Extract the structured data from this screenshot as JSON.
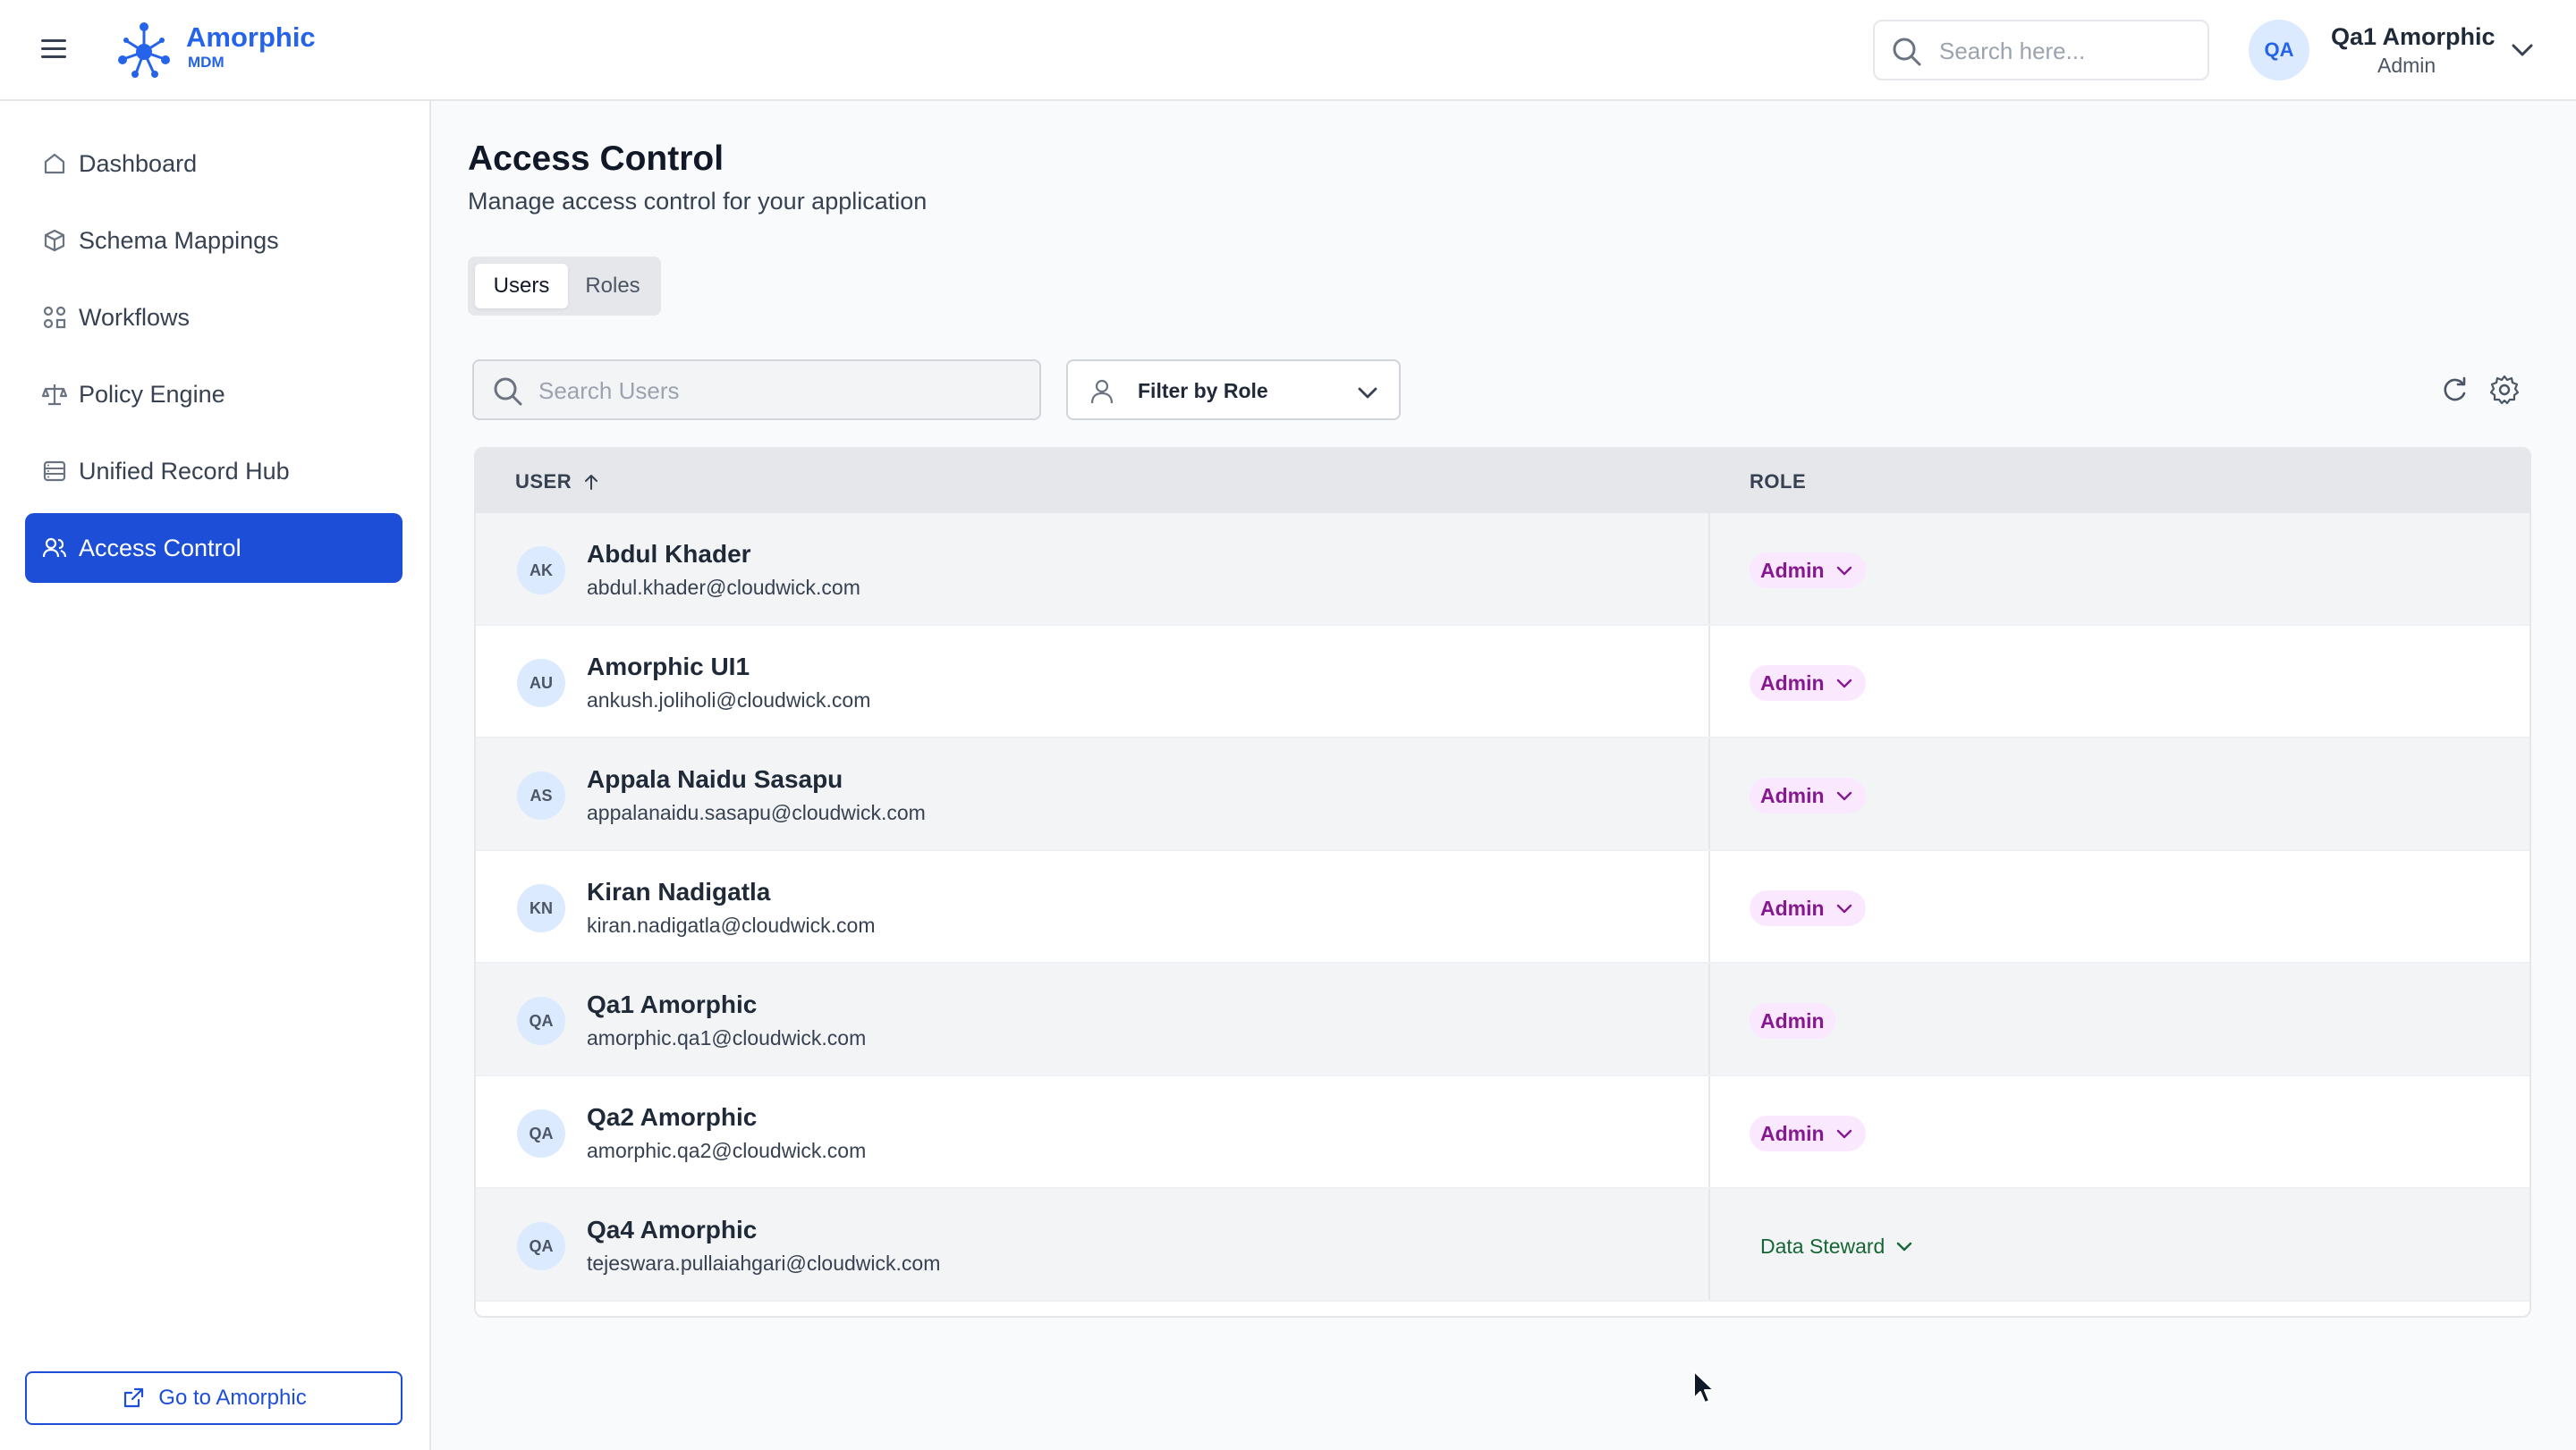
{
  "header": {
    "brand_name": "Amorphic",
    "brand_sub": "MDM",
    "search_placeholder": "Search here...",
    "user": {
      "initials": "QA",
      "name": "Qa1 Amorphic",
      "role": "Admin"
    }
  },
  "sidebar": {
    "items": [
      {
        "label": "Dashboard",
        "icon": "home-icon"
      },
      {
        "label": "Schema Mappings",
        "icon": "cube-icon"
      },
      {
        "label": "Workflows",
        "icon": "workflow-icon"
      },
      {
        "label": "Policy Engine",
        "icon": "scale-icon"
      },
      {
        "label": "Unified Record Hub",
        "icon": "database-icon"
      },
      {
        "label": "Access Control",
        "icon": "users-icon"
      }
    ],
    "footer_button": "Go to Amorphic"
  },
  "page": {
    "title": "Access Control",
    "subtitle": "Manage access control for your application",
    "tabs": [
      "Users",
      "Roles"
    ],
    "active_tab": "Users"
  },
  "toolbar": {
    "search_placeholder": "Search Users",
    "filter_label": "Filter by Role"
  },
  "table": {
    "columns": [
      "USER",
      "ROLE"
    ],
    "sort": "ascending",
    "rows": [
      {
        "initials": "AK",
        "name": "Abdul Khader",
        "email": "abdul.khader@cloudwick.com",
        "role": "Admin",
        "editable": true
      },
      {
        "initials": "AU",
        "name": "Amorphic UI1",
        "email": "ankush.joliholi@cloudwick.com",
        "role": "Admin",
        "editable": true
      },
      {
        "initials": "AS",
        "name": "Appala Naidu Sasapu",
        "email": "appalanaidu.sasapu@cloudwick.com",
        "role": "Admin",
        "editable": true
      },
      {
        "initials": "KN",
        "name": "Kiran Nadigatla",
        "email": "kiran.nadigatla@cloudwick.com",
        "role": "Admin",
        "editable": true
      },
      {
        "initials": "QA",
        "name": "Qa1 Amorphic",
        "email": "amorphic.qa1@cloudwick.com",
        "role": "Admin",
        "editable": false
      },
      {
        "initials": "QA",
        "name": "Qa2 Amorphic",
        "email": "amorphic.qa2@cloudwick.com",
        "role": "Admin",
        "editable": true
      },
      {
        "initials": "QA",
        "name": "Qa4 Amorphic",
        "email": "tejeswara.pullaiahgari@cloudwick.com",
        "role": "Data Steward",
        "editable": true
      }
    ]
  },
  "colors": {
    "primary": "#1d4ed8",
    "brand": "#2563eb",
    "admin_badge_bg": "#fae8ff",
    "admin_badge_text": "#86198f",
    "steward_text": "#166534"
  }
}
